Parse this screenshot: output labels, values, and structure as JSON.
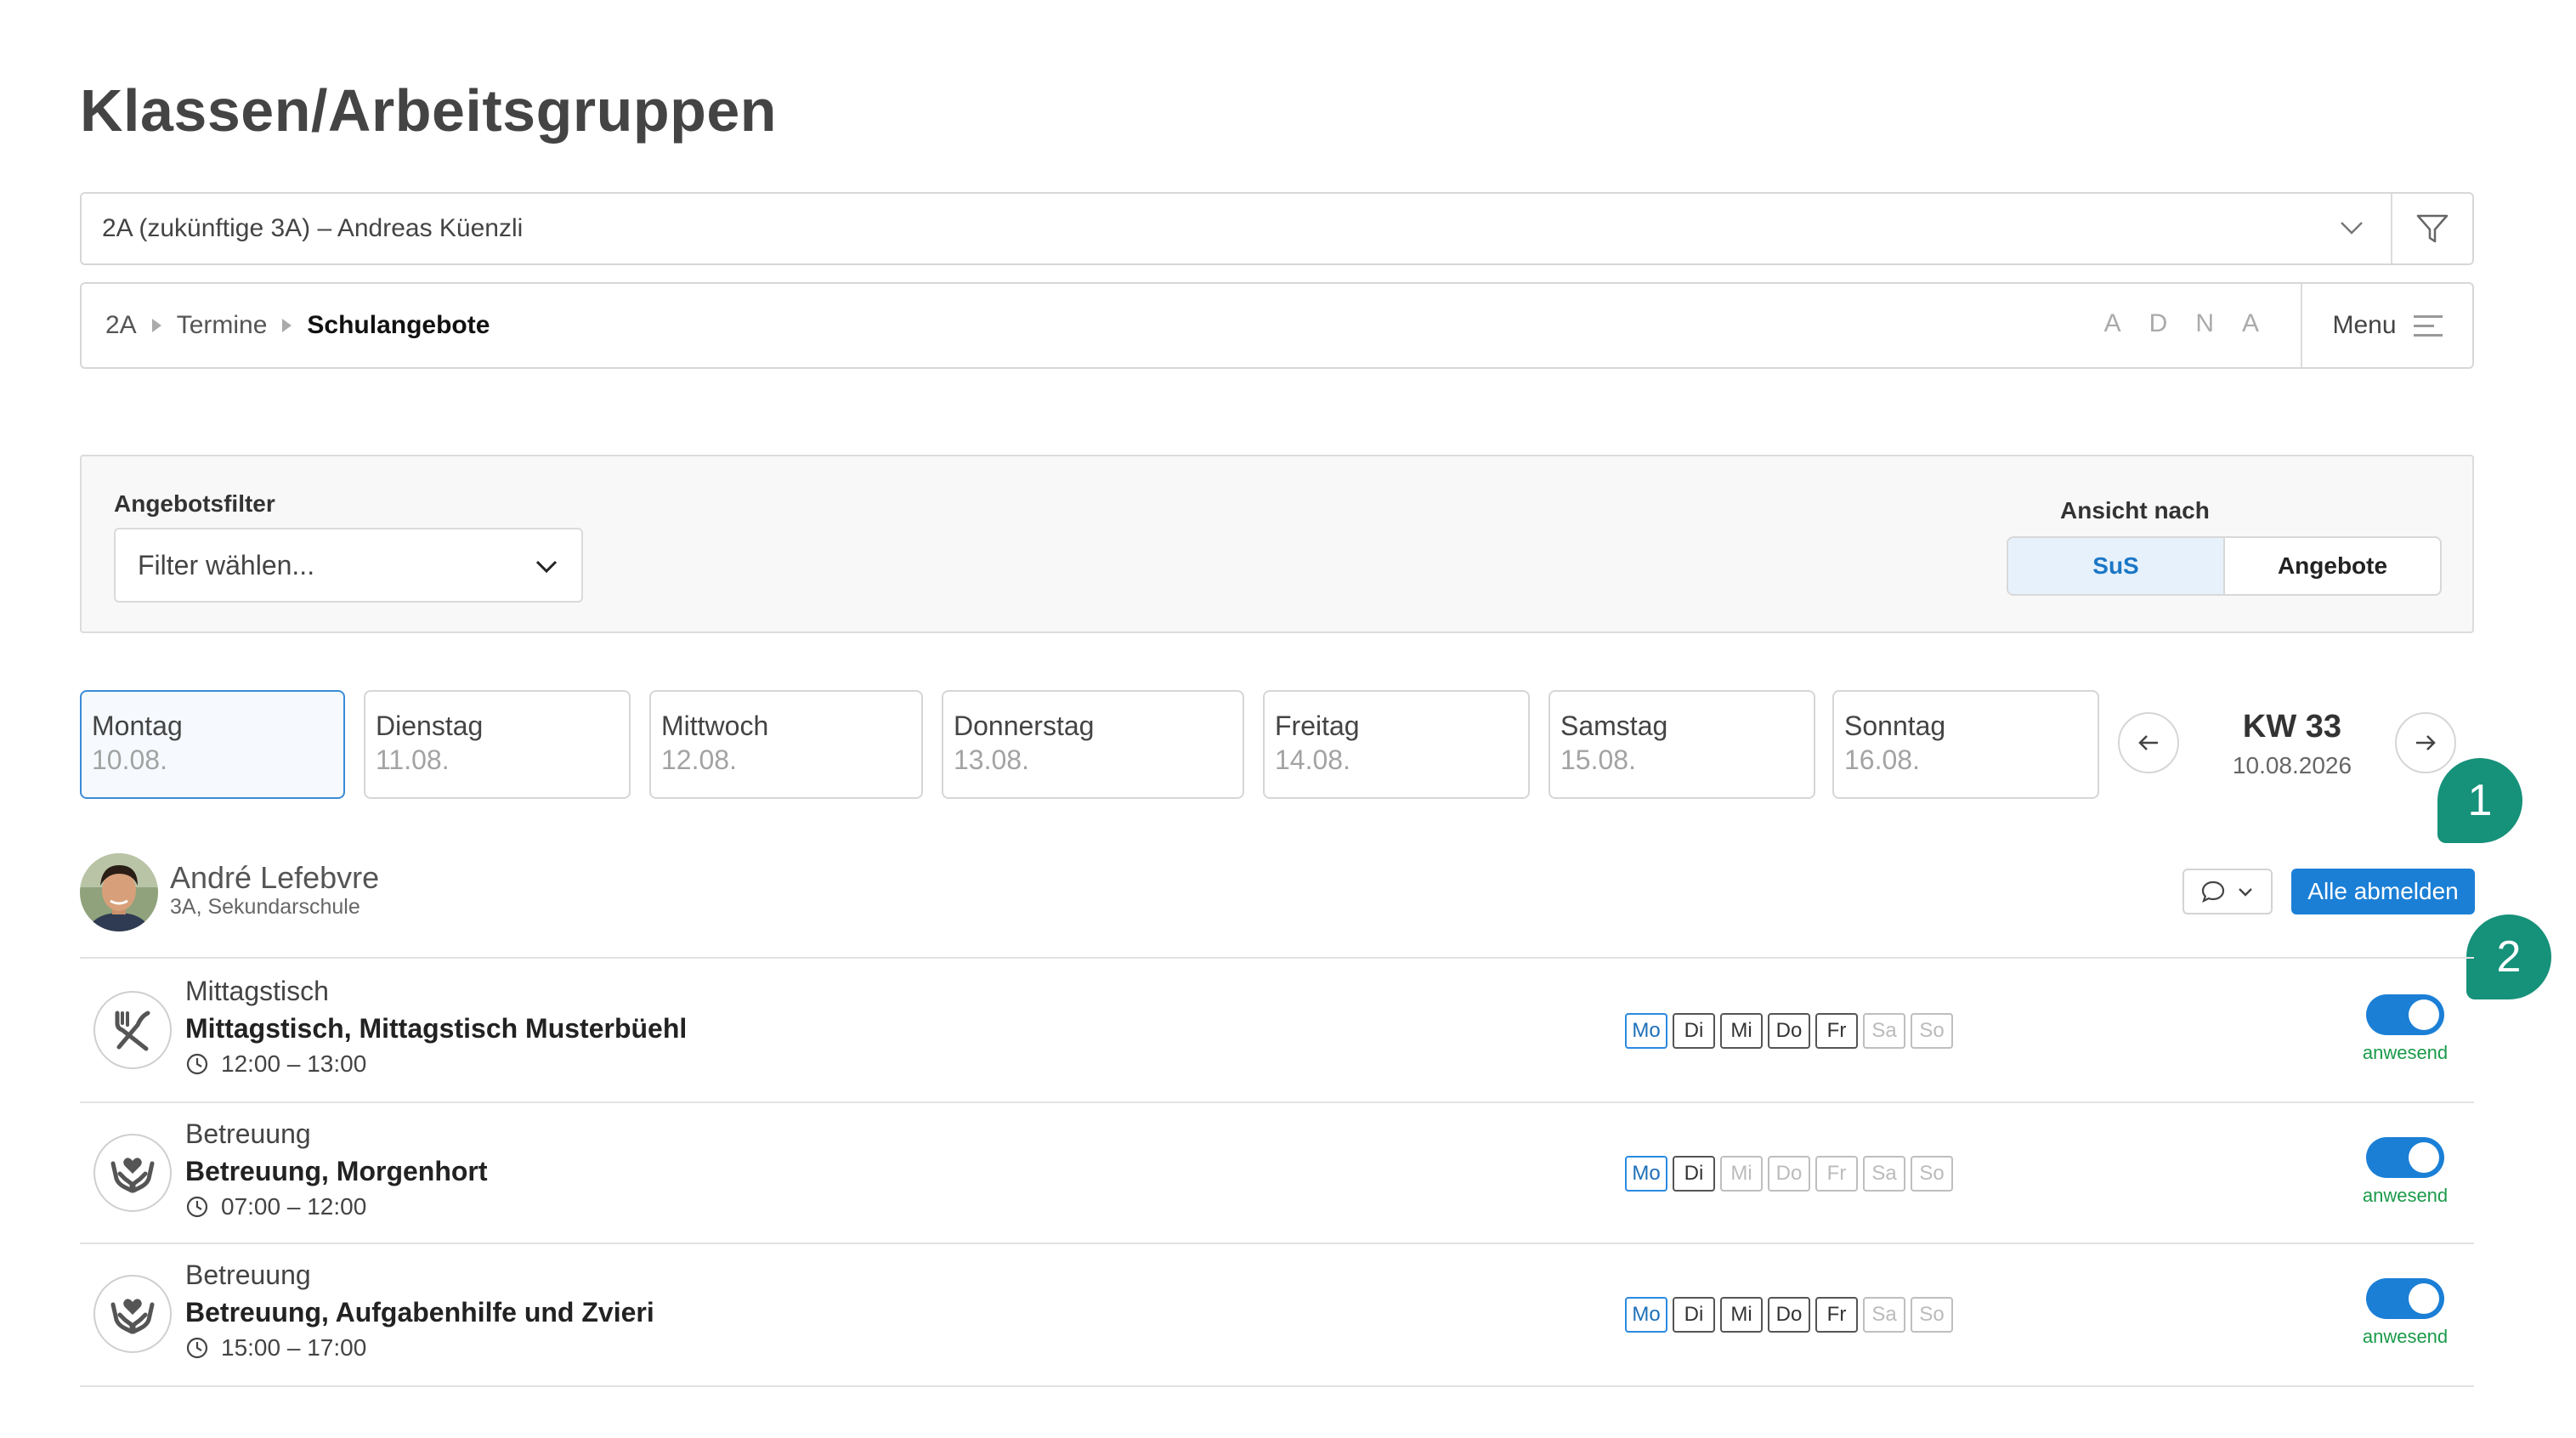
{
  "page_title": "Klassen/Arbeitsgruppen",
  "class_select": {
    "value": "2A (zukünftige 3A) – Andreas Küenzli"
  },
  "breadcrumb": {
    "items": [
      "2A",
      "Termine"
    ],
    "current": "Schulangebote"
  },
  "font_letters": [
    "A",
    "D",
    "N",
    "A"
  ],
  "menu": {
    "label": "Menu"
  },
  "filter_panel": {
    "offer_filter_label": "Angebotsfilter",
    "offer_filter_placeholder": "Filter wählen...",
    "view_label": "Ansicht nach",
    "view_options": [
      "SuS",
      "Angebote"
    ],
    "view_selected": "SuS"
  },
  "days": [
    {
      "name": "Montag",
      "date": "10.08."
    },
    {
      "name": "Dienstag",
      "date": "11.08."
    },
    {
      "name": "Mittwoch",
      "date": "12.08."
    },
    {
      "name": "Donnerstag",
      "date": "13.08."
    },
    {
      "name": "Freitag",
      "date": "14.08."
    },
    {
      "name": "Samstag",
      "date": "15.08."
    },
    {
      "name": "Sonntag",
      "date": "16.08."
    }
  ],
  "selected_day": "Montag",
  "week": {
    "label": "KW 33",
    "date": "10.08.2026"
  },
  "callouts": [
    "1",
    "2"
  ],
  "person": {
    "name": "André Lefebvre",
    "subtitle": "3A, Sekundarschule"
  },
  "unsubscribe_all_label": "Alle abmelden",
  "weekday_abbrevs": [
    "Mo",
    "Di",
    "Mi",
    "Do",
    "Fr",
    "Sa",
    "So"
  ],
  "offers": [
    {
      "category": "Mittagstisch",
      "title": "Mittagstisch, Mittagstisch Musterbüehl",
      "time": "12:00 – 13:00",
      "icon": "fork-knife-icon",
      "active_days": [
        "Mo",
        "Di",
        "Mi",
        "Do",
        "Fr"
      ],
      "attending": true,
      "status_label": "anwesend"
    },
    {
      "category": "Betreuung",
      "title": "Betreuung, Morgenhort",
      "time": "07:00 – 12:00",
      "icon": "hands-heart-icon",
      "active_days": [
        "Mo",
        "Di"
      ],
      "attending": true,
      "status_label": "anwesend"
    },
    {
      "category": "Betreuung",
      "title": "Betreuung, Aufgabenhilfe und Zvieri",
      "time": "15:00 – 17:00",
      "icon": "hands-heart-icon",
      "active_days": [
        "Mo",
        "Di",
        "Mi",
        "Do",
        "Fr"
      ],
      "attending": true,
      "status_label": "anwesend"
    }
  ],
  "colors": {
    "accent": "#1b7fd6",
    "callout": "#16917a",
    "status_ok": "#1a9a4a"
  }
}
